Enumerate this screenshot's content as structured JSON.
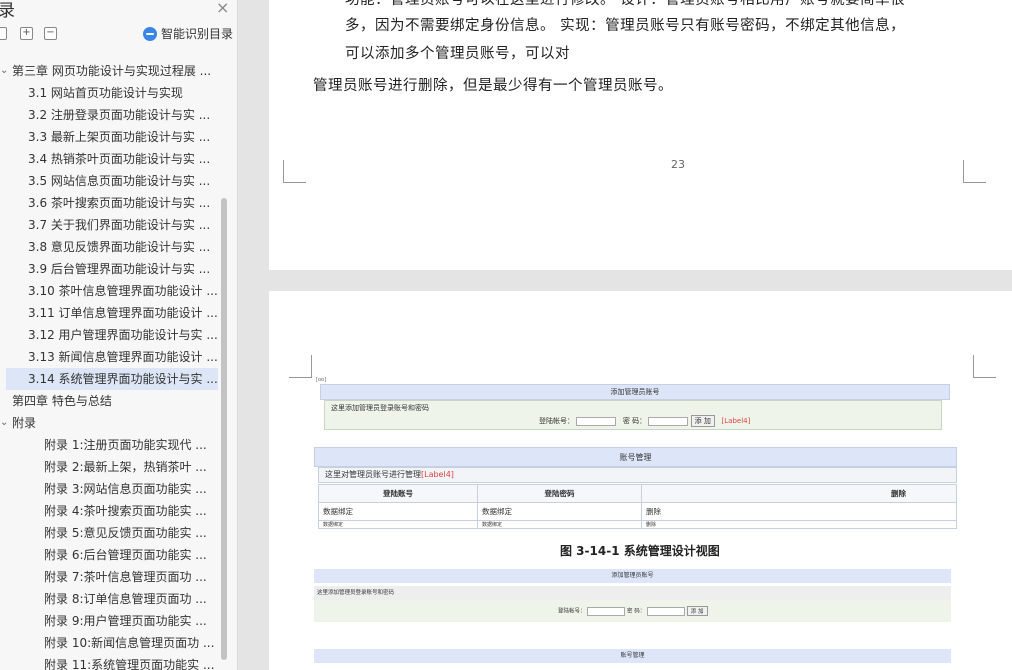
{
  "sidebar": {
    "title": "录",
    "close_label": "×",
    "expand_label": "+",
    "collapse_label": "−",
    "smart_toc_label": "智能识别目录",
    "items": [
      {
        "label": "第三章 网页功能设计与实现过程展 ...",
        "level": 0,
        "expanded": true
      },
      {
        "label": "3.1 网站首页功能设计与实现",
        "level": 1
      },
      {
        "label": "3.2 注册登录页面功能设计与实 ...",
        "level": 1
      },
      {
        "label": "3.3 最新上架页面功能设计与实 ...",
        "level": 1
      },
      {
        "label": "3.4 热销茶叶页面功能设计与实 ...",
        "level": 1
      },
      {
        "label": "3.5 网站信息页面功能设计与实 ...",
        "level": 1
      },
      {
        "label": "3.6 茶叶搜索页面功能设计与实 ...",
        "level": 1
      },
      {
        "label": "3.7 关于我们界面功能设计与实 ...",
        "level": 1
      },
      {
        "label": "3.8 意见反馈界面功能设计与实 ...",
        "level": 1
      },
      {
        "label": "3.9 后台管理界面功能设计与实 ...",
        "level": 1
      },
      {
        "label": "3.10 茶叶信息管理界面功能设计 ...",
        "level": 1
      },
      {
        "label": "3.11 订单信息管理界面功能设计 ...",
        "level": 1
      },
      {
        "label": "3.12 用户管理界面功能设计与实 ...",
        "level": 1
      },
      {
        "label": "3.13 新闻信息管理界面功能设计 ...",
        "level": 1
      },
      {
        "label": "3.14 系统管理界面功能设计与实 ...",
        "level": 1,
        "selected": true
      },
      {
        "label": "第四章 特色与总结",
        "level": 0
      },
      {
        "label": "附录",
        "level": 0,
        "expanded": true
      },
      {
        "label": "附录 1:注册页面功能实现代 ...",
        "level": 2
      },
      {
        "label": "附录 2:最新上架，热销茶叶 ...",
        "level": 2
      },
      {
        "label": "附录 3:网站信息页面功能实 ...",
        "level": 2
      },
      {
        "label": "附录 4:茶叶搜索页面功能实 ...",
        "level": 2
      },
      {
        "label": "附录 5:意见反馈页面功能实 ...",
        "level": 2
      },
      {
        "label": "附录 6:后台管理页面功能实 ...",
        "level": 2
      },
      {
        "label": "附录 7:茶叶信息管理页面功 ...",
        "level": 2
      },
      {
        "label": "附录 8:订单信息管理页面功 ...",
        "level": 2
      },
      {
        "label": "附录 9:用户管理页面功能实 ...",
        "level": 2
      },
      {
        "label": "附录 10:新闻信息管理页面功 ...",
        "level": 2
      },
      {
        "label": "附录 11:系统管理页面功能实 ...",
        "level": 2
      }
    ]
  },
  "page1": {
    "line1": "功能：管理员账号可以在这里进行修改。  设计：管理员账号相比用户账号就要简单很",
    "line2": "多，因为不需要绑定身份信息。 实现：管理员账号只有账号密码，不绑定其他信息，",
    "line3": "可以添加多个管理员账号，可以对",
    "line4": "管理员账号进行删除，但是最少得有一个管理员账号。",
    "page_number": "23"
  },
  "figure1": {
    "corner_label": "[oo]",
    "add_header": "添加管理员账号",
    "add_hint": "这里添加管理员登录账号和密码",
    "login_label": "登陆帐号：",
    "password_label": "密 码：",
    "add_button": "添 加",
    "add_tag": "[Label4]",
    "manage_header": "账号管理",
    "manage_hint": "这里对管理员账号进行管理",
    "manage_tag": "[Label4]",
    "columns": [
      "登陆账号",
      "登陆密码",
      "删除"
    ],
    "rows": [
      [
        "数据绑定",
        "数据绑定",
        "删除"
      ],
      [
        "数据绑定",
        "数据绑定",
        "删除"
      ]
    ]
  },
  "caption": "图 3-14-1 系统管理设计视图",
  "figure2": {
    "add_header": "添加管理员账号",
    "add_hint": "这里添加管理员登录账号和密码",
    "login_label": "登陆帐号：",
    "password_label": "密 码：",
    "add_button": "添 加",
    "manage_header": "账号管理"
  }
}
